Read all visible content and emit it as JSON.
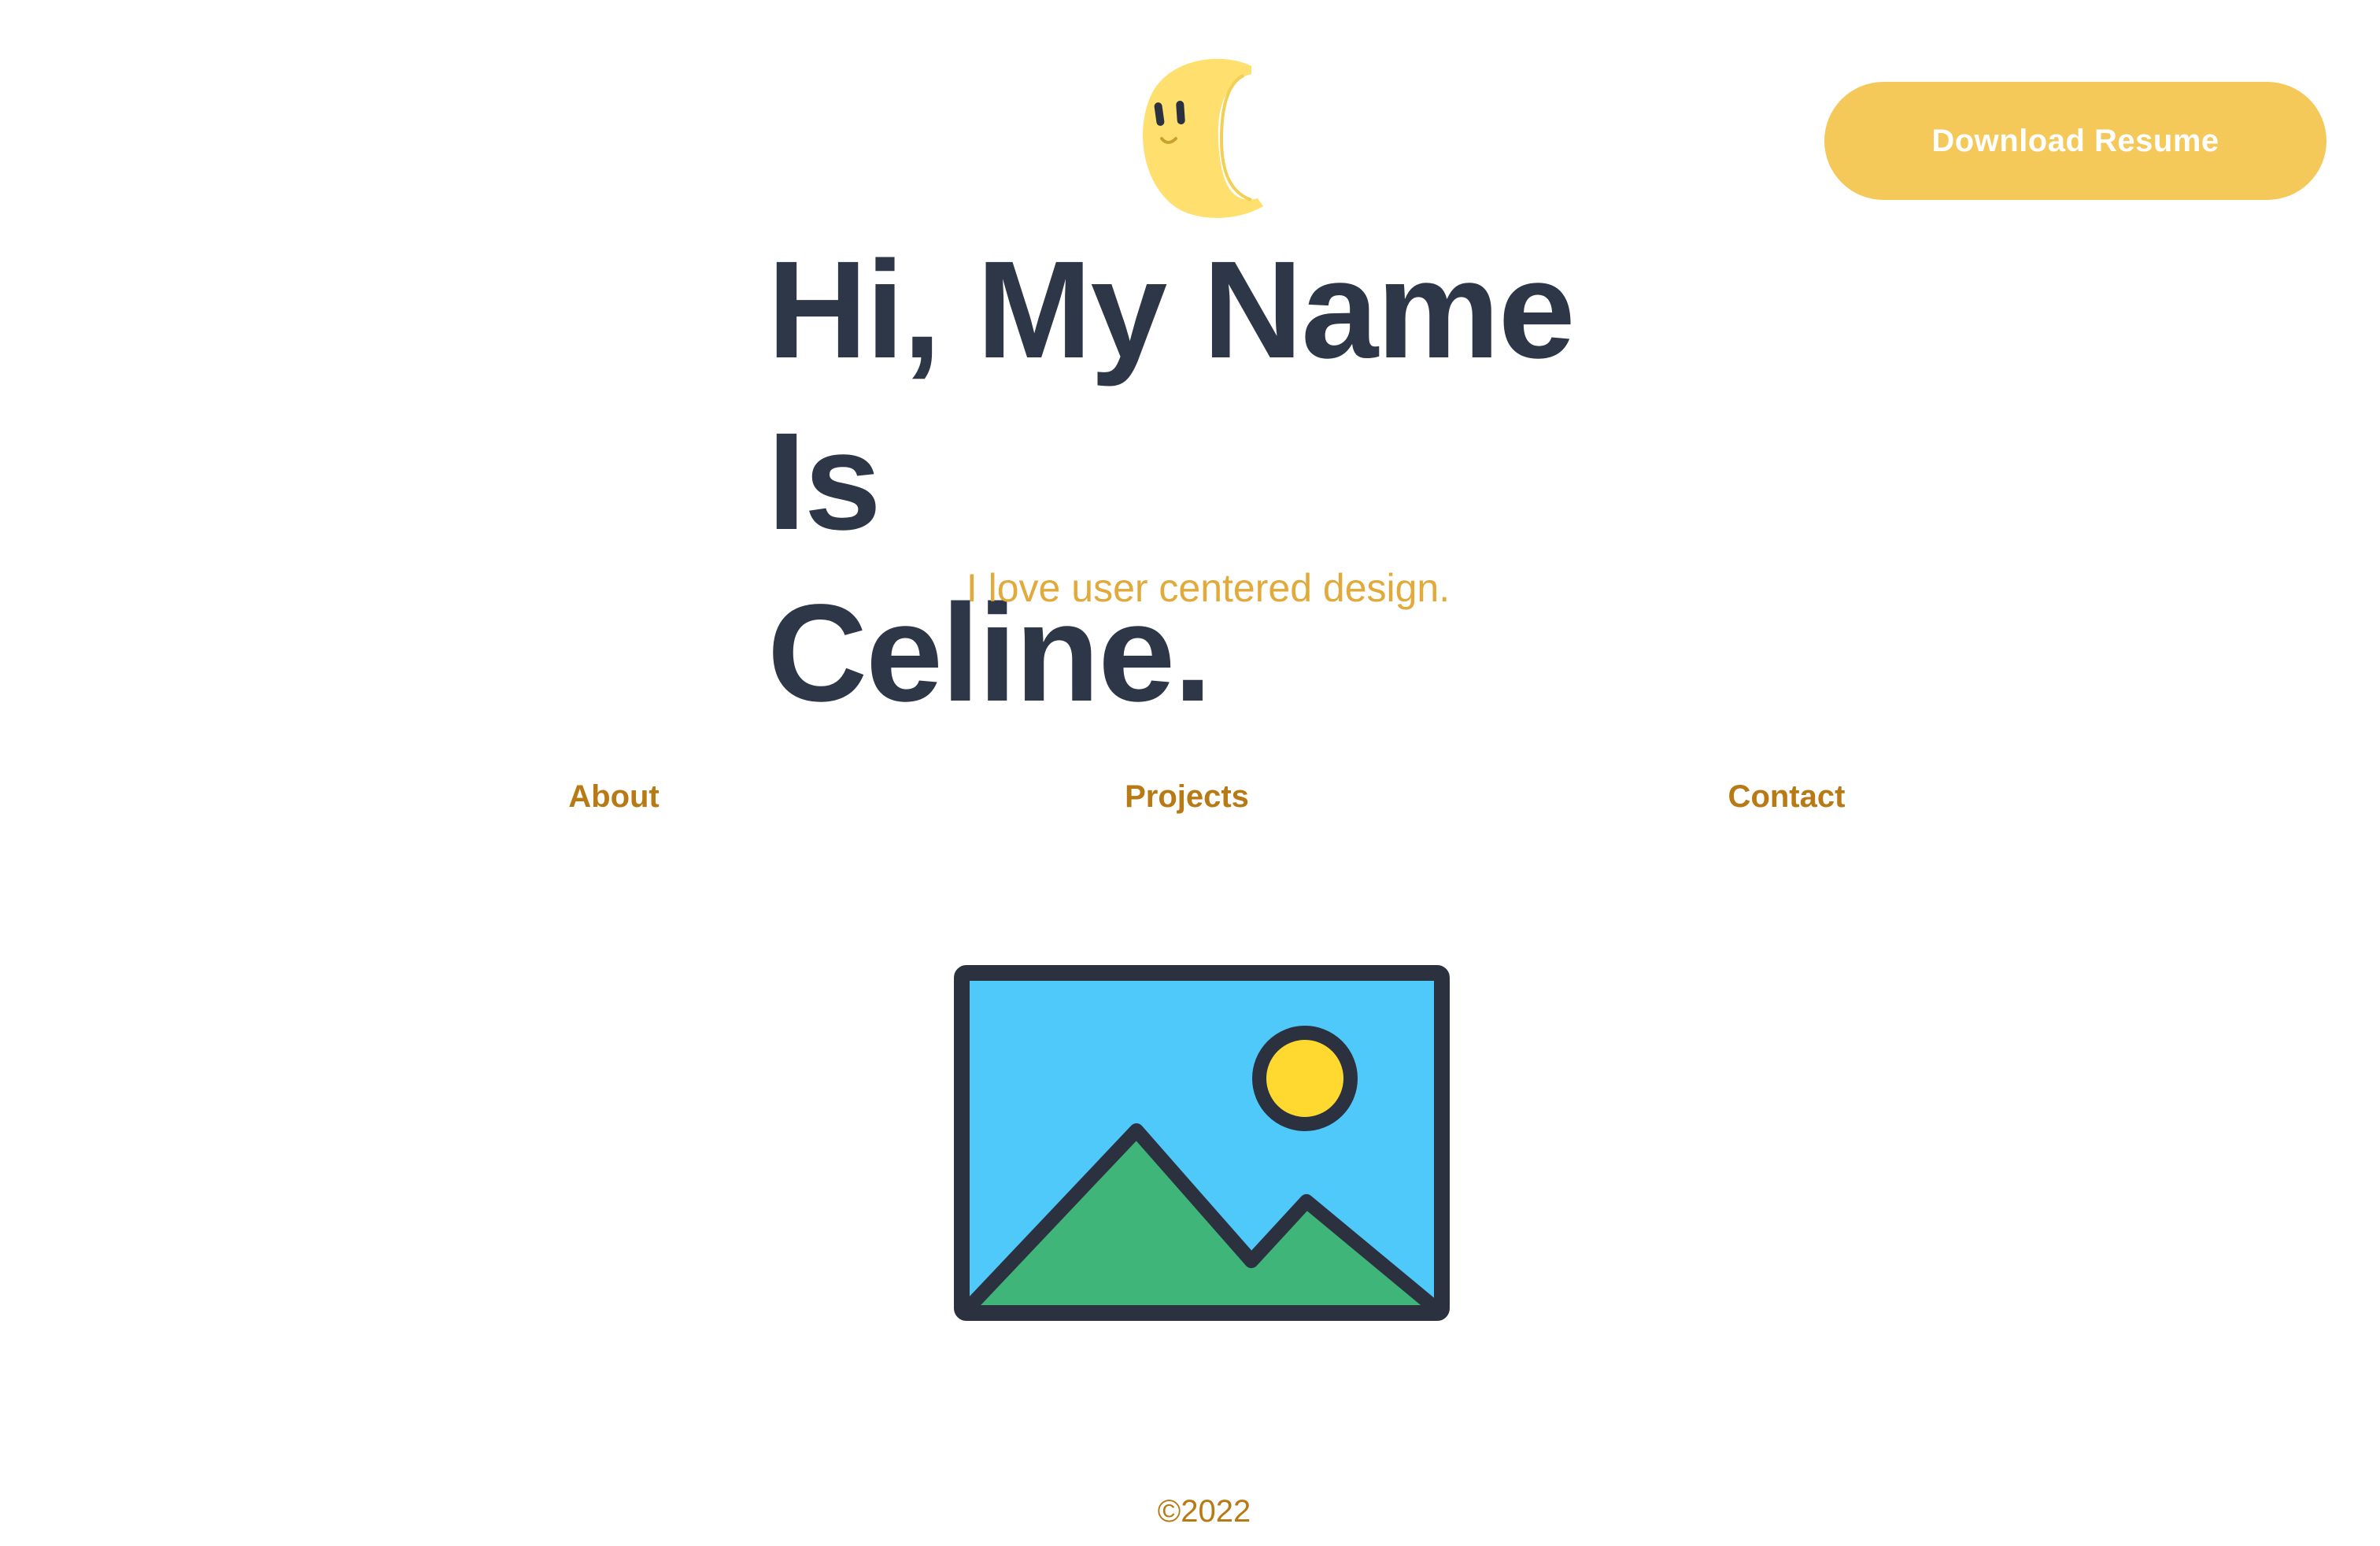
{
  "header": {
    "logo_icon": "moon-mascot-icon",
    "download_resume_label": "Download Resume"
  },
  "hero": {
    "title_line1": "Hi, My Name Is",
    "title_line2": "Celine.",
    "tagline": "I love user centered design."
  },
  "nav": {
    "items": [
      {
        "label": "About"
      },
      {
        "label": "Projects"
      },
      {
        "label": "Contact"
      }
    ]
  },
  "main": {
    "image_icon": "image-placeholder-icon"
  },
  "footer": {
    "copyright": "©2022"
  },
  "colors": {
    "accent": "#F5C85A",
    "title": "#2E3748",
    "tagline": "#E2A93B",
    "nav": "#B77A14",
    "moon": "#FFE06E",
    "sky": "#4FC8FA",
    "sun": "#FFD930",
    "hills": "#3FB57A",
    "outline": "#2C3140"
  }
}
